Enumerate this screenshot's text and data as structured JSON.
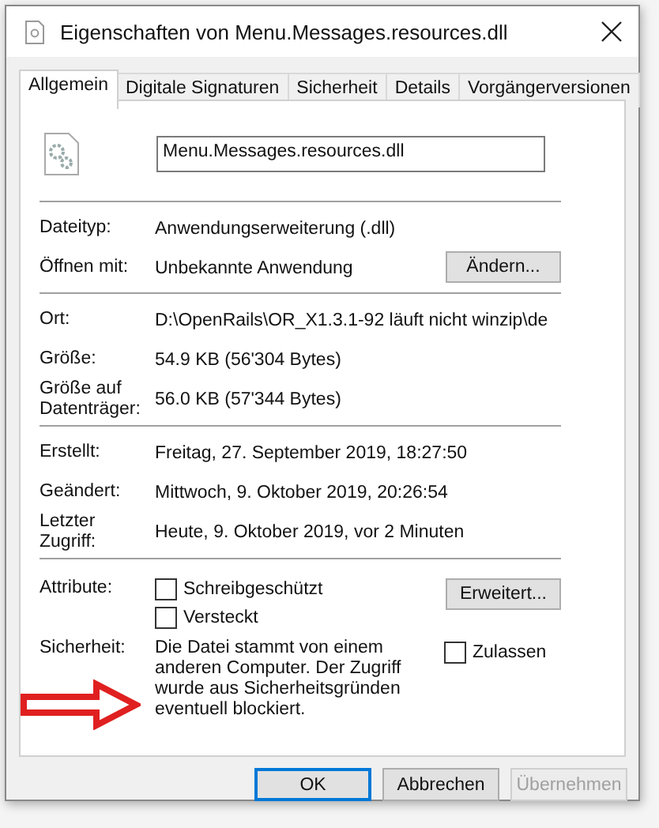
{
  "window": {
    "title": "Eigenschaften von Menu.Messages.resources.dll"
  },
  "tabs": [
    {
      "label": "Allgemein",
      "selected": true
    },
    {
      "label": "Digitale Signaturen",
      "selected": false
    },
    {
      "label": "Sicherheit",
      "selected": false
    },
    {
      "label": "Details",
      "selected": false
    },
    {
      "label": "Vorgängerversionen",
      "selected": false
    }
  ],
  "file_name": "Menu.Messages.resources.dll",
  "type_section": [
    {
      "label": "Dateityp:",
      "value": "Anwendungserweiterung (.dll)"
    },
    {
      "label": "Öffnen mit:",
      "value": "Unbekannte Anwendung",
      "button": "Ändern..."
    }
  ],
  "location_section": [
    {
      "label": "Ort:",
      "value": "D:\\OpenRails\\OR_X1.3.1-92 läuft nicht winzip\\de"
    },
    {
      "label": "Größe:",
      "value": "54.9 KB (56'304 Bytes)"
    },
    {
      "label": "Größe auf Datenträger:",
      "value": "56.0 KB (57'344 Bytes)"
    }
  ],
  "date_section": [
    {
      "label": "Erstellt:",
      "value": "Freitag, 27. September 2019, 18:27:50"
    },
    {
      "label": "Geändert:",
      "value": "Mittwoch, 9. Oktober 2019, 20:26:54"
    },
    {
      "label": "Letzter Zugriff:",
      "value": "Heute, 9. Oktober 2019, vor 2 Minuten"
    }
  ],
  "attributes": {
    "label": "Attribute:",
    "options": [
      {
        "label": "Schreibgeschützt",
        "checked": false
      },
      {
        "label": "Versteckt",
        "checked": false
      }
    ],
    "button": "Erweitert..."
  },
  "security": {
    "label": "Sicherheit:",
    "text": "Die Datei stammt von einem anderen Computer. Der Zugriff wurde aus Sicherheitsgründen eventuell blockiert.",
    "option": {
      "label": "Zulassen",
      "checked": false
    }
  },
  "buttons": [
    {
      "label": "OK",
      "kind": "default",
      "disabled": false
    },
    {
      "label": "Abbrechen",
      "kind": "normal",
      "disabled": false
    },
    {
      "label": "Übernehmen",
      "kind": "normal",
      "disabled": true
    }
  ]
}
